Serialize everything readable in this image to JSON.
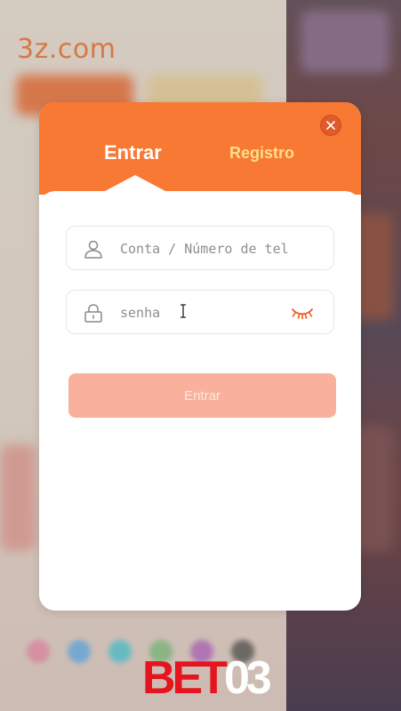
{
  "background": {
    "brand_text": "3z.com"
  },
  "modal": {
    "tabs": [
      {
        "label": "Entrar",
        "active": true
      },
      {
        "label": "Registro",
        "active": false
      }
    ],
    "close_icon": "close-icon",
    "account": {
      "icon": "user-icon",
      "placeholder": "Conta / Número de telefone",
      "value": ""
    },
    "password": {
      "icon": "lock-icon",
      "placeholder": "senha",
      "value": "",
      "toggle_icon": "eye-closed-icon"
    },
    "submit_label": "Entrar"
  },
  "watermark": {
    "part1": "BET",
    "part2": "03"
  },
  "colors": {
    "accent": "#f87934",
    "tab_inactive": "#ffdf8a",
    "button_disabled": "#f9b19e",
    "eye_icon": "#ee5a24"
  }
}
